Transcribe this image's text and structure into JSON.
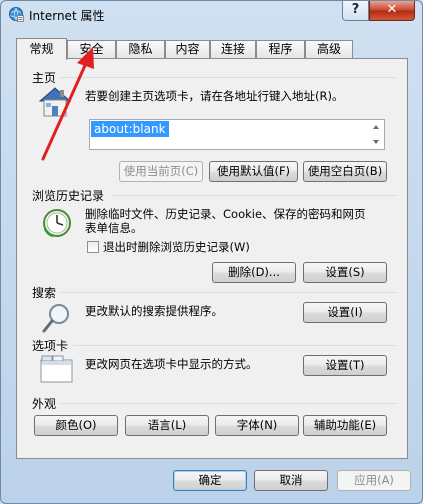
{
  "window": {
    "title": "Internet 属性",
    "help_label": "?",
    "close_label": "✕"
  },
  "tabs": [
    {
      "label": "常规",
      "active": true
    },
    {
      "label": "安全",
      "active": false
    },
    {
      "label": "隐私",
      "active": false
    },
    {
      "label": "内容",
      "active": false
    },
    {
      "label": "连接",
      "active": false
    },
    {
      "label": "程序",
      "active": false
    },
    {
      "label": "高级",
      "active": false
    }
  ],
  "homepage": {
    "section_label": "主页",
    "description": "若要创建主页选项卡，请在各地址行键入地址(R)。",
    "address_value": "about:blank",
    "buttons": {
      "use_current": "使用当前页(C)",
      "use_default": "使用默认值(F)",
      "use_blank": "使用空白页(B)"
    }
  },
  "history": {
    "section_label": "浏览历史记录",
    "description_line1": "删除临时文件、历史记录、Cookie、保存的密码和网页",
    "description_line2": "表单信息。",
    "checkbox_label": "退出时删除浏览历史记录(W)",
    "checkbox_checked": false,
    "buttons": {
      "delete": "删除(D)...",
      "settings": "设置(S)"
    }
  },
  "search": {
    "section_label": "搜索",
    "description": "更改默认的搜索提供程序。",
    "settings_label": "设置(I)"
  },
  "tabs_section": {
    "section_label": "选项卡",
    "description": "更改网页在选项卡中显示的方式。",
    "settings_label": "设置(T)"
  },
  "appearance": {
    "section_label": "外观",
    "buttons": {
      "colors": "颜色(O)",
      "languages": "语言(L)",
      "fonts": "字体(N)",
      "accessibility": "辅助功能(E)"
    }
  },
  "footer": {
    "ok": "确定",
    "cancel": "取消",
    "apply": "应用(A)"
  },
  "annotation_color": "#e02020"
}
